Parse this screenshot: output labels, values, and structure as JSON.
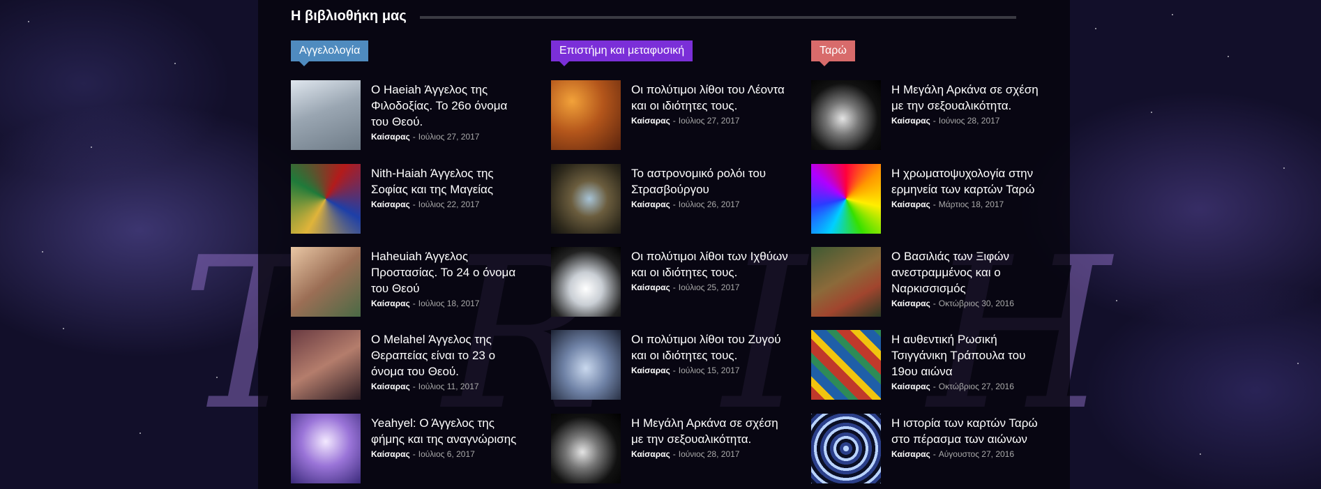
{
  "section": {
    "title": "Η βιβλιοθήκη μας"
  },
  "watermark": "T R I H G R",
  "columns": [
    {
      "category": {
        "label": "Αγγελολογία",
        "color": "#4f8bbf"
      },
      "posts": [
        {
          "title": "Ο Haeiah Άγγελος της Φιλοδοξίας. Το 26ο όνομα του Θεού.",
          "author": "Καίσαρας",
          "date": "Ιούλιος 27, 2017",
          "thumb": "angel-statue"
        },
        {
          "title": "Nith-Haiah Άγγελος της Σοφίας και της Μαγείας",
          "author": "Καίσαρας",
          "date": "Ιούλιος 22, 2017",
          "thumb": "stained-glass"
        },
        {
          "title": "Haheuiah Άγγελος Προστασίας. Το 24 ο όνομα του Θεού",
          "author": "Καίσαρας",
          "date": "Ιούλιος 18, 2017",
          "thumb": "guardian-angel-haheuiah"
        },
        {
          "title": "Ο Melahel Άγγελος της Θεραπείας είναι το 23 ο όνομα του Θεού.",
          "author": "Καίσαρας",
          "date": "Ιούλιος 11, 2017",
          "thumb": "guardian-angel-melahel"
        },
        {
          "title": "Yeahyel: Ο Άγγελος της φήμης και της αναγνώρισης",
          "author": "Καίσαρας",
          "date": "Ιούλιος 6, 2017",
          "thumb": "angel-purple"
        }
      ]
    },
    {
      "category": {
        "label": "Επιστήμη και μεταφυσική",
        "color": "#7b2fd8"
      },
      "posts": [
        {
          "title": "Οι πολύτιμοι λίθοι του Λέοντα και οι ιδιότητες τους.",
          "author": "Καίσαρας",
          "date": "Ιούλιος 27, 2017",
          "thumb": "amber-stones"
        },
        {
          "title": "Το αστρονομικό ρολόι του Στρασβούργου",
          "author": "Καίσαρας",
          "date": "Ιούλιος 26, 2017",
          "thumb": "astronomical-clock"
        },
        {
          "title": "Οι πολύτιμοι λίθοι των Ιχθύων και οι ιδιότητες τους.",
          "author": "Καίσαρας",
          "date": "Ιούλιος 25, 2017",
          "thumb": "quartz-crystal"
        },
        {
          "title": "Οι πολύτιμοι λίθοι του Ζυγού και οι ιδιότητες τους.",
          "author": "Καίσαρας",
          "date": "Ιούλιος 15, 2017",
          "thumb": "gem-seal"
        },
        {
          "title": "Η Μεγάλη Αρκάνα σε σχέση με την σεξουαλικότητα.",
          "author": "Καίσαρας",
          "date": "Ιούνιος 28, 2017",
          "thumb": "silver-figure"
        }
      ]
    },
    {
      "category": {
        "label": "Ταρώ",
        "color": "#d86b6b"
      },
      "posts": [
        {
          "title": "Η Μεγάλη Αρκάνα σε σχέση με την σεξουαλικότητα.",
          "author": "Καίσαρας",
          "date": "Ιούνιος 28, 2017",
          "thumb": "silver-figure"
        },
        {
          "title": "Η χρωματοψυχολογία στην ερμηνεία των καρτών Ταρώ",
          "author": "Καίσαρας",
          "date": "Μάρτιος 18, 2017",
          "thumb": "color-spiral"
        },
        {
          "title": "Ο Βασιλιάς των Ξιφών ανεστραμμένος και ο Ναρκισσισμός",
          "author": "Καίσαρας",
          "date": "Οκτώβριος 30, 2016",
          "thumb": "narcissus-painting"
        },
        {
          "title": "Η αυθεντική Ρωσική Τσιγγάνικη Τράπουλα του 19ου αιώνα",
          "author": "Καίσαρας",
          "date": "Οκτώβριος 27, 2016",
          "thumb": "tarot-cards"
        },
        {
          "title": "Η ιστορία των καρτών Ταρώ στο πέρασμα των αιώνων",
          "author": "Καίσαρας",
          "date": "Αύγουστος 27, 2016",
          "thumb": "mandala"
        }
      ]
    }
  ]
}
